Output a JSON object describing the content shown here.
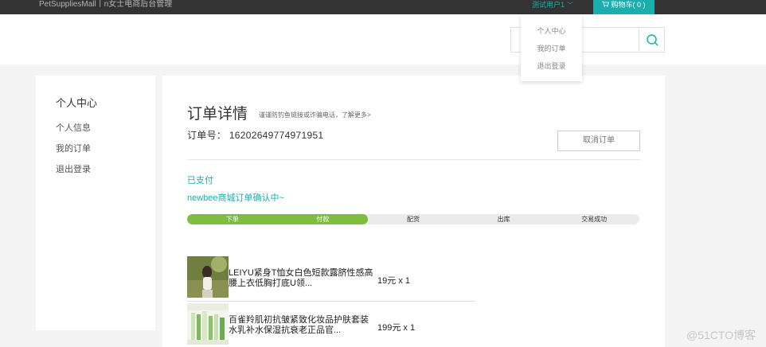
{
  "topbar": {
    "brand": "PetSuppliesMall丨n女士电商后台管理",
    "user_label": "测试用户1",
    "user_chevron": "﹀",
    "cart_icon": "🛒",
    "cart_label": "购物车( 0 )"
  },
  "dropdown": {
    "items": [
      "个人中心",
      "我的订单",
      "退出登录"
    ]
  },
  "search": {
    "value": "",
    "icon": "search-icon"
  },
  "sidebar": {
    "title": "个人中心",
    "items": [
      "个人信息",
      "我的订单",
      "退出登录"
    ]
  },
  "order": {
    "title": "订单详情",
    "hint": "谨谨防钓鱼链接或诈骗电话，了解更多>",
    "order_no": "订单号： 16202649774971951",
    "cancel_label": "取消订单",
    "status_paid": "已支付",
    "status_msg": "newbee商城订单确认中~",
    "progress": {
      "steps": [
        "下单",
        "付款",
        "配货",
        "出库",
        "交易成功"
      ],
      "completed_fraction": 0.4
    },
    "goods": [
      {
        "name": "LEIYU紧身T恤女白色短款露脐性感高腰上衣低胸打底U领...",
        "price": "19元 x 1"
      },
      {
        "name": "百雀羚肌初抗皱紧致化妆品护肤套装水乳补水保湿抗衰老正品官...",
        "price": "199元 x 1"
      }
    ]
  },
  "watermark": "@51CTO博客",
  "colors": {
    "accent": "#1baeae",
    "progress_done": "#7ebe3c",
    "topbar_bg": "#333333"
  }
}
